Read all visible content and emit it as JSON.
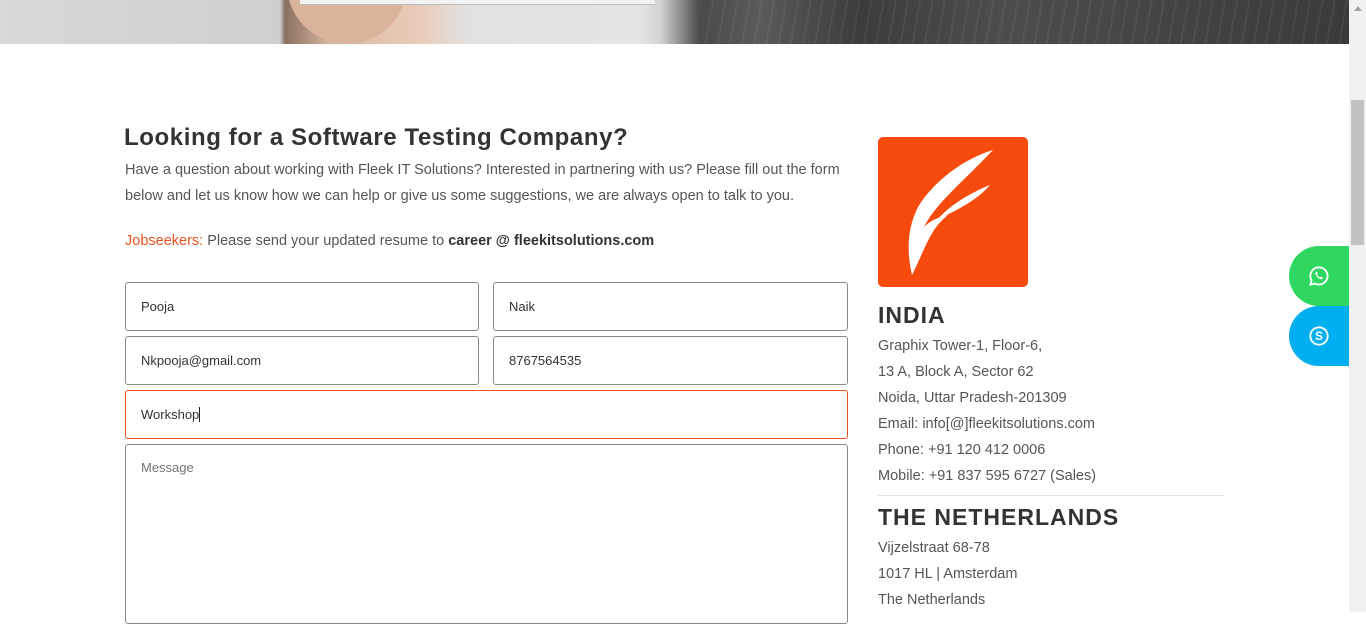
{
  "hero": {
    "image": "businessman-holding-card"
  },
  "contact": {
    "heading": "Looking for a Software Testing Company?",
    "intro": "Have a question about working with Fleek IT Solutions? Interested in partnering with us? Please fill out the form below and let us know how we can help or give us some suggestions, we are always open to talk to you.",
    "jobseekers_label": "Jobseekers:",
    "jobseekers_text": " Please send your updated resume to ",
    "jobseekers_email": "career @ fleekitsolutions.com"
  },
  "form": {
    "first_name": "Pooja",
    "last_name": "Naik",
    "email": "Nkpooja@gmail.com",
    "phone": "8767564535",
    "subject": "Workshop",
    "message_placeholder": "Message"
  },
  "logo": {
    "brand": "Fleek IT Solutions",
    "color": "#f74a0d"
  },
  "offices": [
    {
      "title": "INDIA",
      "lines": [
        "Graphix Tower-1, Floor-6,",
        "13 A, Block A, Sector 62",
        "Noida, Uttar Pradesh-201309",
        "Email: info[@]fleekitsolutions.com",
        "Phone: +91 120 412 0006",
        "Mobile: +91 837 595 6727 (Sales)"
      ]
    },
    {
      "title": "THE NETHERLANDS",
      "lines": [
        "Vijzelstraat 68-78",
        "1017 HL | Amsterdam",
        "The Netherlands"
      ]
    }
  ],
  "floating": {
    "whatsapp_color": "#2fd65f",
    "skype_color": "#00aff0"
  },
  "colors": {
    "accent": "#e8531f",
    "text": "#555555",
    "heading": "#333333"
  }
}
